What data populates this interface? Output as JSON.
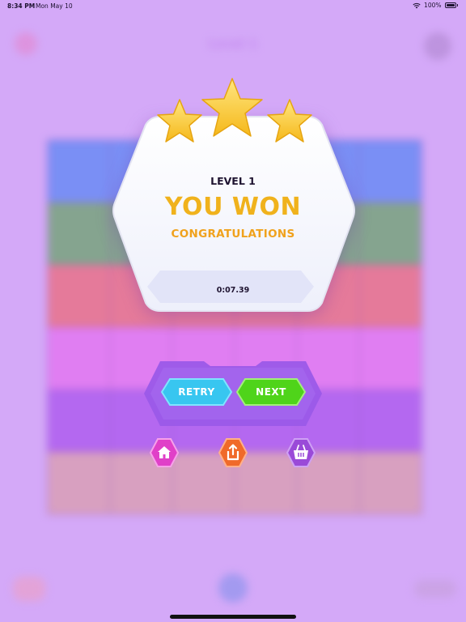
{
  "status_bar": {
    "time": "8:34 PM",
    "date": "Mon May 10",
    "battery": "100%"
  },
  "background_game": {
    "title": "Level 1",
    "grid_rows": 6,
    "grid_columns": 6
  },
  "win_dialog": {
    "stars_earned": 3,
    "level_label": "LEVEL 1",
    "headline": "YOU WON",
    "subheadline": "CONGRATULATIONS",
    "time": "0:07.39"
  },
  "actions": {
    "retry_label": "RETRY",
    "next_label": "NEXT",
    "home_icon": "home-icon",
    "share_icon": "share-icon",
    "shop_icon": "shopping-basket-icon"
  },
  "colors": {
    "background": "#d4a9f8",
    "headline": "#f0b21c",
    "retry": "#38c6f0",
    "next": "#4fd41a",
    "home": "#e040c8",
    "share": "#f06a2a",
    "shop": "#9a4ad8"
  }
}
